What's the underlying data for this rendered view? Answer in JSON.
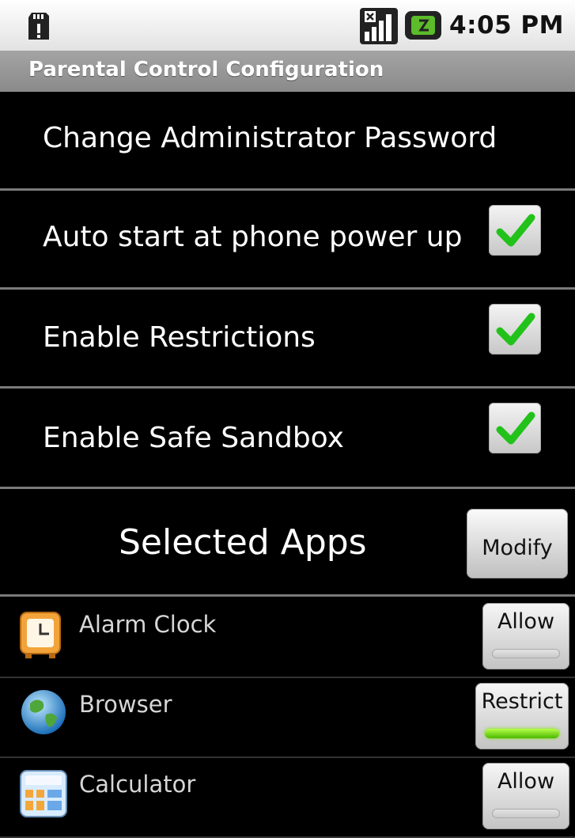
{
  "status_bar": {
    "time": "4:05 PM",
    "icons": [
      "sd-card-icon",
      "signal-icon",
      "battery-icon"
    ]
  },
  "title_bar": {
    "title": "Parental Control Configuration"
  },
  "settings": {
    "change_password": {
      "label": "Change Administrator Password"
    },
    "auto_start": {
      "label": "Auto start at phone power up",
      "checked": true
    },
    "enable_restrictions": {
      "label": "Enable Restrictions",
      "checked": true
    },
    "enable_sandbox": {
      "label": "Enable Safe Sandbox",
      "checked": true
    }
  },
  "selected_apps": {
    "title": "Selected Apps",
    "modify_label": "Modify",
    "apps": [
      {
        "name": "Alarm Clock",
        "icon": "alarm-clock-icon",
        "button_label": "Allow",
        "indicator_on": false
      },
      {
        "name": "Browser",
        "icon": "globe-icon",
        "button_label": "Restrict",
        "indicator_on": true
      },
      {
        "name": "Calculator",
        "icon": "calculator-icon",
        "button_label": "Allow",
        "indicator_on": false
      }
    ]
  },
  "colors": {
    "checkmark": "#22c21a",
    "indicator_on": "#7fe000",
    "title_bar": "#999999"
  }
}
